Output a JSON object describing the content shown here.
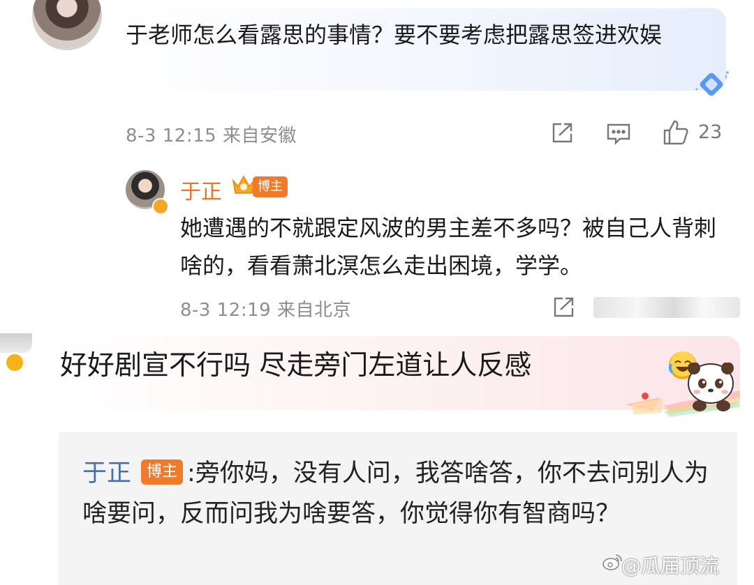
{
  "comment1": {
    "text": "于老师怎么看露思的事情？要不要考虑把露思签进欢娱",
    "date": "8-3 12:15",
    "location": "来自安徽",
    "likes": "23",
    "icons": [
      "share-icon",
      "comment-icon",
      "like-icon",
      "diamond-badge-icon"
    ]
  },
  "reply1": {
    "author": "于正",
    "tag": "博主",
    "text": "她遭遇的不就跟定风波的男主差不多吗？被自己人背刺啥的，看看萧北溟怎么走出困境，学学。",
    "date": "8-3 12:19",
    "location": "来自北京",
    "icons": [
      "share-icon",
      "crown-icon",
      "verified-badge-icon"
    ]
  },
  "comment2": {
    "text": "好好剧宣不行吗 尽走旁门左道让人反感",
    "icons": [
      "laugh-cry-emoji-icon",
      "panda-sticker-icon",
      "verified-badge-icon"
    ]
  },
  "reply2": {
    "author": "于正",
    "tag": "博主",
    "separator": ":",
    "text": "旁你妈，没有人问，我答啥答，你不去问别人为啥要问，反而问我为啥要答，你觉得你有智商吗？"
  },
  "watermark": {
    "text": "@瓜届顶流",
    "icon": "weibo-logo-icon"
  },
  "colors": {
    "author": "#e8752a",
    "tag_bg": "#f07a2b",
    "meta": "#8d8d8d",
    "reply_name": "#4a6fa5",
    "reply_bg": "#f4f4f4"
  }
}
